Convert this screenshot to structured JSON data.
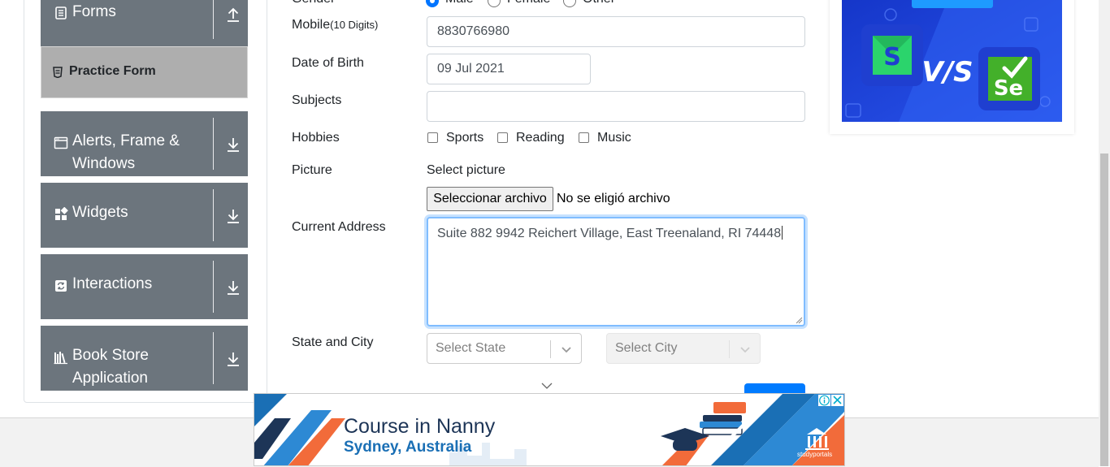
{
  "sidebar": {
    "groups": [
      {
        "label": "Forms",
        "icon": "form-icon",
        "arrow": "collapse-arrow-icon"
      },
      {
        "label_line1": "Alerts, Frame &",
        "label_line2": "Windows",
        "icon": "window-icon",
        "arrow": "expand-arrow-icon"
      },
      {
        "label": "Widgets",
        "icon": "widgets-icon",
        "arrow": "expand-arrow-icon"
      },
      {
        "label": "Interactions",
        "icon": "interactions-icon",
        "arrow": "expand-arrow-icon"
      },
      {
        "label_line1": "Book Store",
        "label_line2": "Application",
        "icon": "bookstore-icon",
        "arrow": "expand-arrow-icon"
      }
    ],
    "active_item": {
      "label": "Practice Form",
      "icon": "practice-form-icon"
    }
  },
  "form": {
    "gender": {
      "label": "Gender",
      "options": [
        "Male",
        "Female",
        "Other"
      ],
      "selected": "Male"
    },
    "mobile": {
      "label": "Mobile",
      "hint": "(10 Digits)",
      "value": "8830766980"
    },
    "dob": {
      "label": "Date of Birth",
      "value": "09 Jul 2021"
    },
    "subjects": {
      "label": "Subjects",
      "value": ""
    },
    "hobbies": {
      "label": "Hobbies",
      "options": [
        "Sports",
        "Reading",
        "Music"
      ]
    },
    "picture": {
      "label": "Picture",
      "select_text": "Select picture",
      "button_label": "Seleccionar archivo",
      "no_file_text": "No se eligió archivo"
    },
    "address": {
      "label": "Current Address",
      "value": "Suite 882 9942 Reichert Village, East Treenaland, RI 74448"
    },
    "state_city": {
      "label": "State and City",
      "state_placeholder": "Select State",
      "city_placeholder": "Select City"
    }
  },
  "right_ad": {
    "logos": [
      "S",
      "V/S",
      "Se"
    ],
    "colors": {
      "bg": "#1d3fd6",
      "katalon": "#27d36b",
      "selenium": "#43b02a"
    }
  },
  "bottom_ad": {
    "line1": "Course in Nanny",
    "line2": "Sydney, Australia",
    "brand": "studyportals",
    "colors": {
      "blue": "#1a6fb5",
      "orange": "#f26b3a",
      "navy": "#1d3557"
    }
  }
}
